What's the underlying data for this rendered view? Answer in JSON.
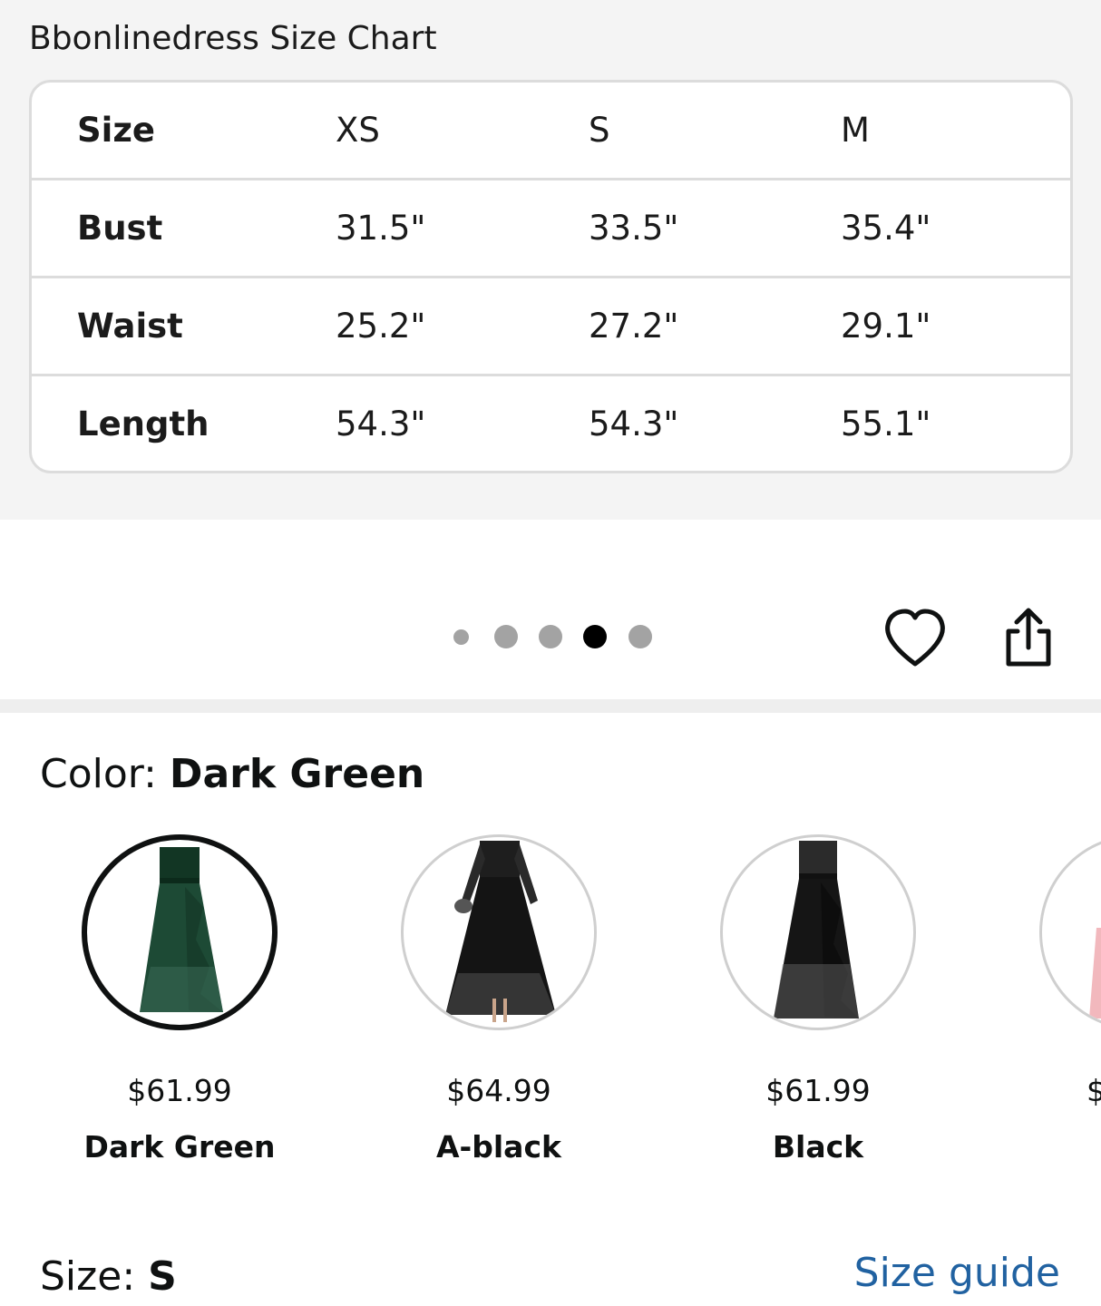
{
  "size_chart": {
    "title": "Bbonlinedress Size Chart",
    "columns": [
      "Size",
      "XS",
      "S",
      "M"
    ],
    "rows": [
      {
        "label": "Bust",
        "values": [
          "31.5\"",
          "33.5\"",
          "35.4\""
        ]
      },
      {
        "label": "Waist",
        "values": [
          "25.2\"",
          "27.2\"",
          "29.1\""
        ]
      },
      {
        "label": "Length",
        "values": [
          "54.3\"",
          "54.3\"",
          "55.1\""
        ]
      }
    ]
  },
  "gallery": {
    "image_count": 5,
    "active_index": 4,
    "icons": [
      "heart-icon",
      "share-icon"
    ]
  },
  "color_picker": {
    "label": "Color: ",
    "selected": "Dark Green",
    "swatches": [
      {
        "price": "$61.99",
        "name": "Dark Green",
        "selected": true,
        "color": "#1d4a35"
      },
      {
        "price": "$64.99",
        "name": "A-black",
        "selected": false,
        "color": "#141414"
      },
      {
        "price": "$61.99",
        "name": "Black",
        "selected": false,
        "color": "#151515"
      },
      {
        "price": "$",
        "name": "",
        "selected": false,
        "color": "#f2b8bd"
      }
    ]
  },
  "size_picker": {
    "label": "Size: ",
    "selected": "S",
    "guide_link": "Size guide"
  },
  "colors": {
    "link": "#2162a1",
    "dot_active": "#000000",
    "dot_inactive": "#a3a3a3"
  }
}
